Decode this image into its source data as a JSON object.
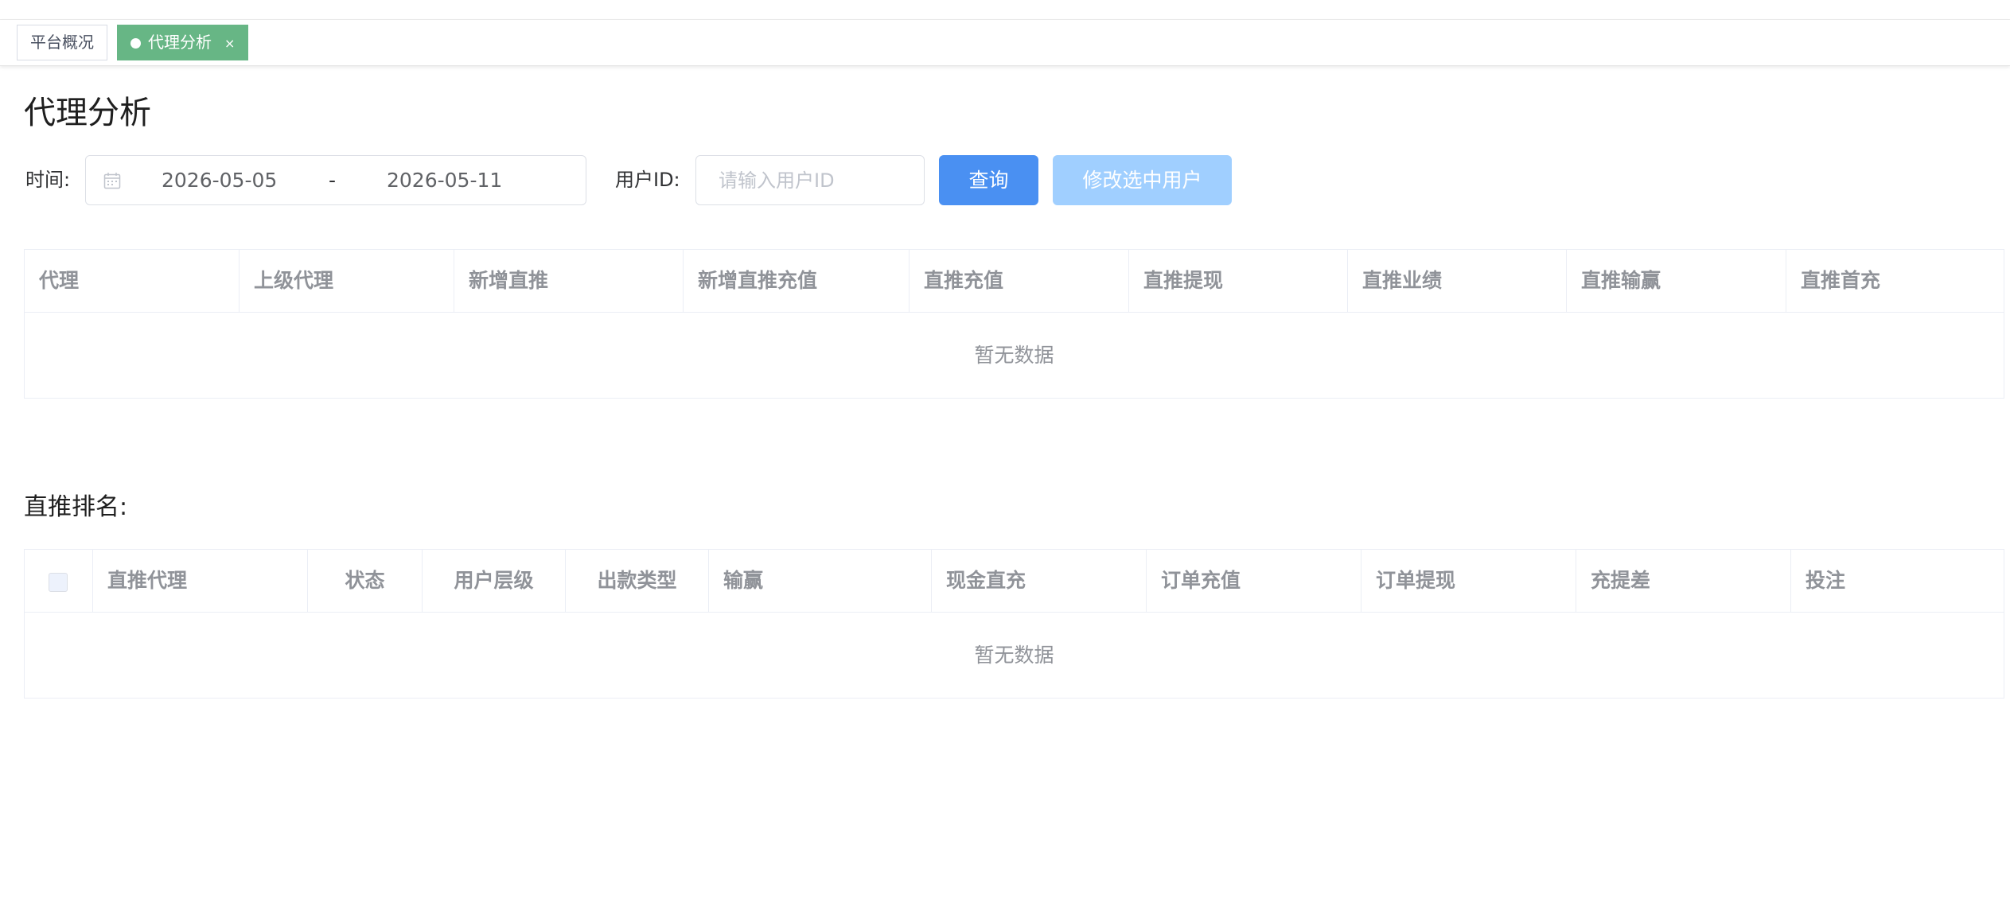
{
  "tabs": [
    {
      "label": "平台概况",
      "active": false
    },
    {
      "label": "代理分析",
      "active": true,
      "close": "×"
    }
  ],
  "page_title": "代理分析",
  "filters": {
    "time_label": "时间:",
    "date_start": "2026-05-05",
    "date_separator": "-",
    "date_end": "2026-05-11",
    "userid_label": "用户ID:",
    "userid_placeholder": "请输入用户ID",
    "userid_value": "",
    "query_button": "查询",
    "modify_button": "修改选中用户"
  },
  "agent_table": {
    "columns": [
      "代理",
      "上级代理",
      "新增直推",
      "新增直推充值",
      "直推充值",
      "直推提现",
      "直推业绩",
      "直推输赢",
      "直推首充"
    ],
    "rows": [],
    "empty_text": "暂无数据"
  },
  "ranking_title": "直推排名:",
  "ranking_table": {
    "columns": [
      "直推代理",
      "状态",
      "用户层级",
      "出款类型",
      "输赢",
      "现金直充",
      "订单充值",
      "订单提现",
      "充提差",
      "投注"
    ],
    "rows": [],
    "empty_text": "暂无数据"
  },
  "colors": {
    "active_tab": "#67b685",
    "primary_button": "#4a90f2",
    "disabled_button": "#a0cfff",
    "header_text": "#909399"
  }
}
